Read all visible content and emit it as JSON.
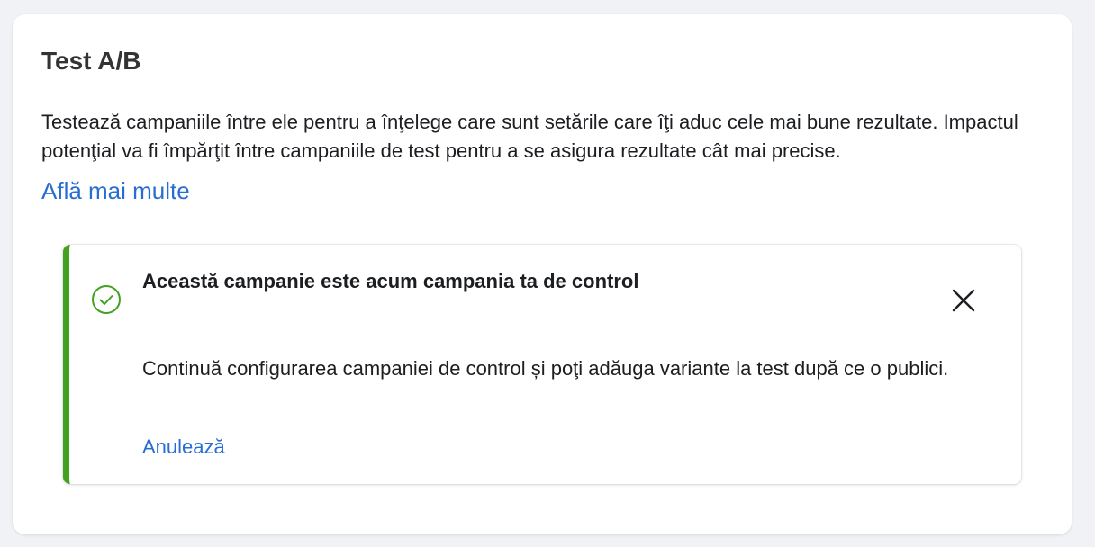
{
  "card": {
    "title": "Test A/B",
    "description": "Testează campaniile între ele pentru a înţelege care sunt setările care îţi aduc cele mai bune rezultate. Impactul potenţial va fi împărţit între campaniile de test pentru a se asigura rezultate cât mai precise.",
    "learn_more_label": "Află mai multe"
  },
  "notice": {
    "icon": "check-circle-icon",
    "title": "Această campanie este acum campania ta de control",
    "body": "Continuă configurarea campaniei de control și poţi adăuga variante la test după ce o publici.",
    "cancel_label": "Anulează",
    "close_icon": "close-icon"
  },
  "colors": {
    "accent_link": "#2a6dd1",
    "success": "#42a121"
  }
}
